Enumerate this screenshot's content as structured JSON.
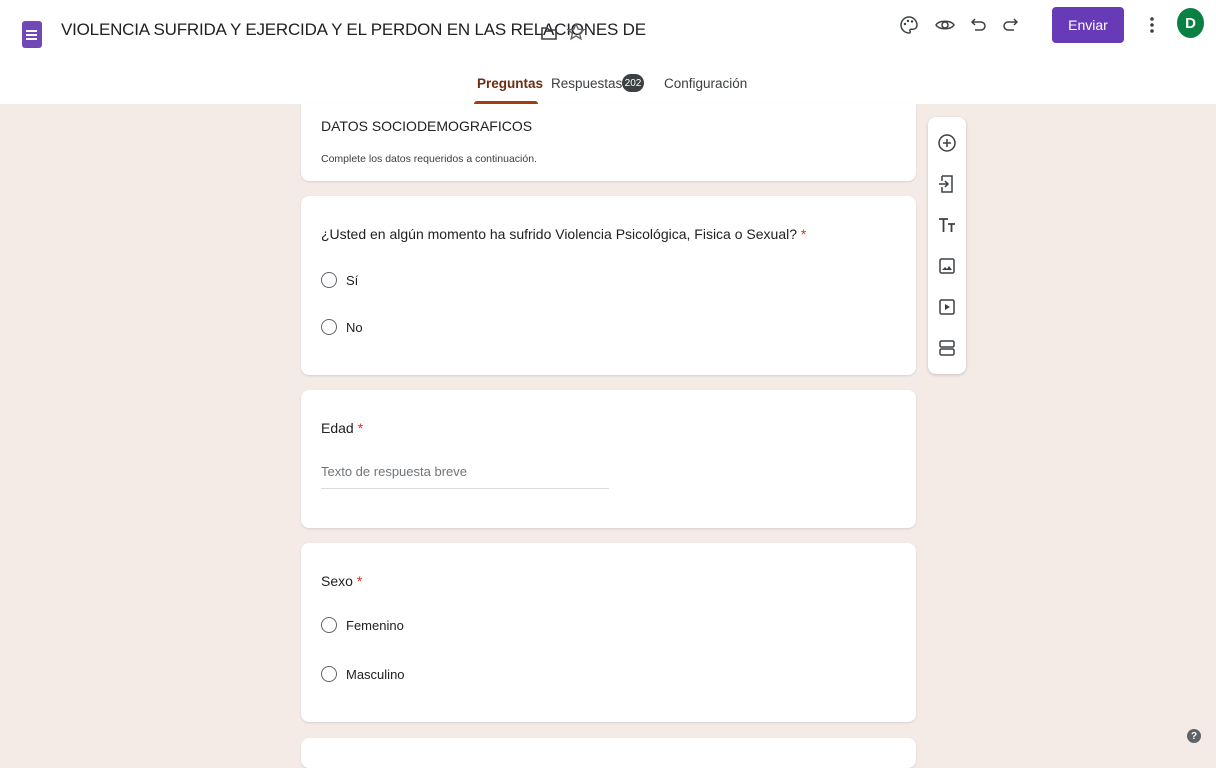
{
  "header": {
    "title": "VIOLENCIA SUFRIDA Y EJERCIDA Y EL PERDON EN LAS RELACIONES DE",
    "send_label": "Enviar",
    "avatar_initial": "D",
    "icons": [
      "forms-app-icon",
      "folder-icon",
      "star-icon",
      "palette-icon",
      "preview-eye-icon",
      "undo-icon",
      "redo-icon",
      "more-vert-icon"
    ]
  },
  "tabs": {
    "questions": "Preguntas",
    "responses": "Respuestas",
    "responses_count": "202",
    "settings": "Configuración"
  },
  "section": {
    "title": "DATOS SOCIODEMOGRAFICOS",
    "description": "Complete los datos requeridos a continuación."
  },
  "questions": [
    {
      "title": "¿Usted en algún momento ha sufrido Violencia Psicológica, Fisica o Sexual?",
      "required_mark": "*",
      "options": [
        "Sí",
        "No"
      ]
    },
    {
      "title": "Edad",
      "required_mark": "*",
      "answer_placeholder": "Texto de respuesta breve"
    },
    {
      "title": "Sexo",
      "required_mark": "*",
      "options": [
        "Femenino",
        "Masculino"
      ]
    }
  ],
  "sidebar": {
    "icons": [
      "add-question-icon",
      "import-questions-icon",
      "add-title-icon",
      "add-image-icon",
      "add-video-icon",
      "add-section-icon"
    ]
  },
  "help": {
    "label": "?"
  },
  "colors": {
    "accent": "#673ab7",
    "background": "#f4ebe7",
    "active_tab": "#a23d0e",
    "required": "#d93025",
    "avatar": "#0b8043"
  }
}
